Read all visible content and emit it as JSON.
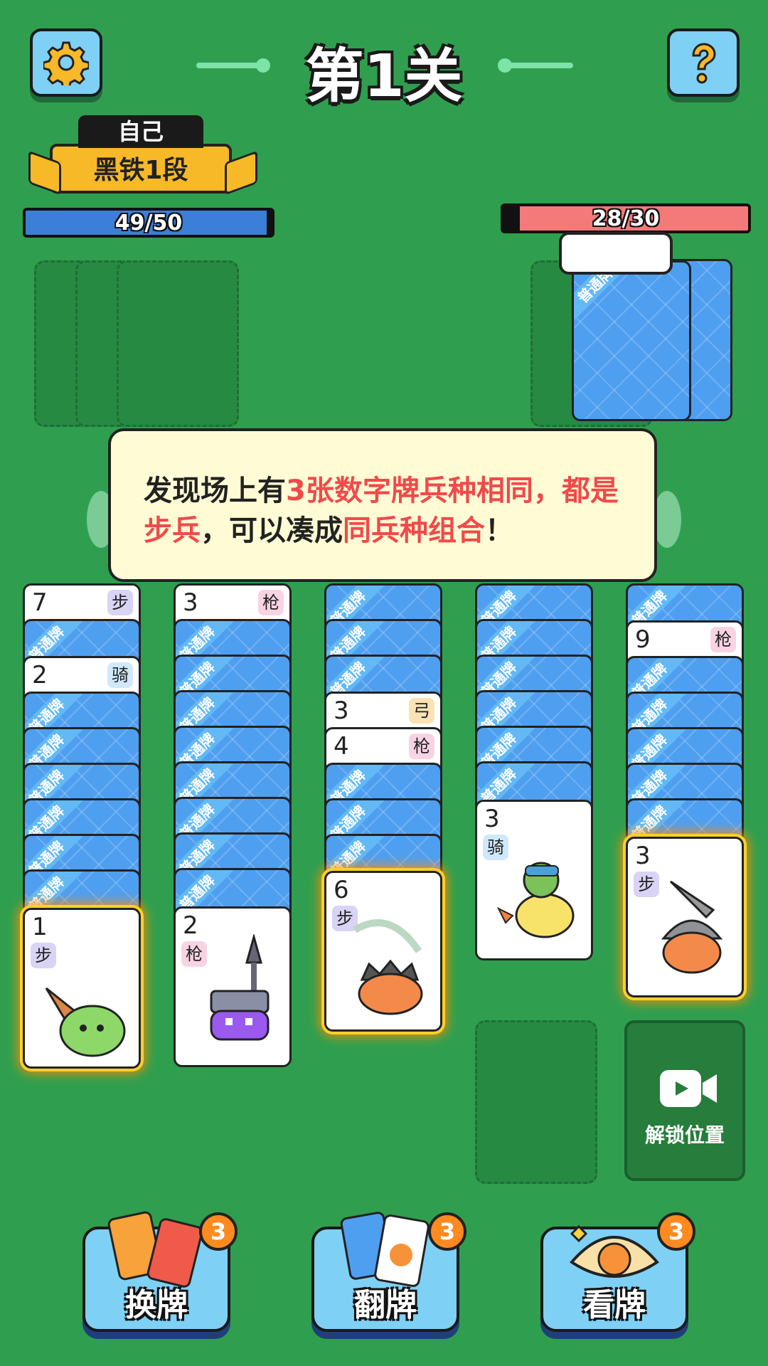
{
  "header": {
    "title": "第1关",
    "settings_icon": "gear-icon",
    "help_icon": "question-icon"
  },
  "player": {
    "name": "自己",
    "rank": "黑铁1段",
    "hp_text": "49/50",
    "hp_fraction": 0.98,
    "hp_color": "#3b7fd9"
  },
  "opponent": {
    "hp_text": "28/30",
    "hp_fraction": 0.933,
    "hp_color": "#f47a7a",
    "speech_text": ""
  },
  "card_back_label": "普通牌",
  "tip": {
    "part1": "发现场上有",
    "part2": "3张数字牌兵种相同，都是步兵",
    "part3": "，可以凑成",
    "part4": "同兵种组合",
    "part5": "！"
  },
  "columns": [
    {
      "top": {
        "num": "7",
        "type": "步"
      },
      "mid": {
        "num": "2",
        "type": "骑"
      },
      "front": {
        "num": "1",
        "type": "步"
      }
    },
    {
      "top": {
        "num": "3",
        "type": "枪"
      },
      "front": {
        "num": "2",
        "type": "枪"
      }
    },
    {
      "mid1": {
        "num": "3",
        "type": "弓"
      },
      "mid2": {
        "num": "4",
        "type": "枪"
      },
      "front": {
        "num": "6",
        "type": "步"
      }
    },
    {
      "front": {
        "num": "3",
        "type": "骑"
      }
    },
    {
      "mid": {
        "num": "9",
        "type": "枪"
      },
      "front": {
        "num": "3",
        "type": "步"
      }
    }
  ],
  "unlock": {
    "label": "解锁位置",
    "icon": "video-camera-icon"
  },
  "powerups": [
    {
      "label": "换牌",
      "count": "3",
      "icon": "swap-cards-icon"
    },
    {
      "label": "翻牌",
      "count": "3",
      "icon": "flip-card-icon"
    },
    {
      "label": "看牌",
      "count": "3",
      "icon": "eye-icon"
    }
  ]
}
